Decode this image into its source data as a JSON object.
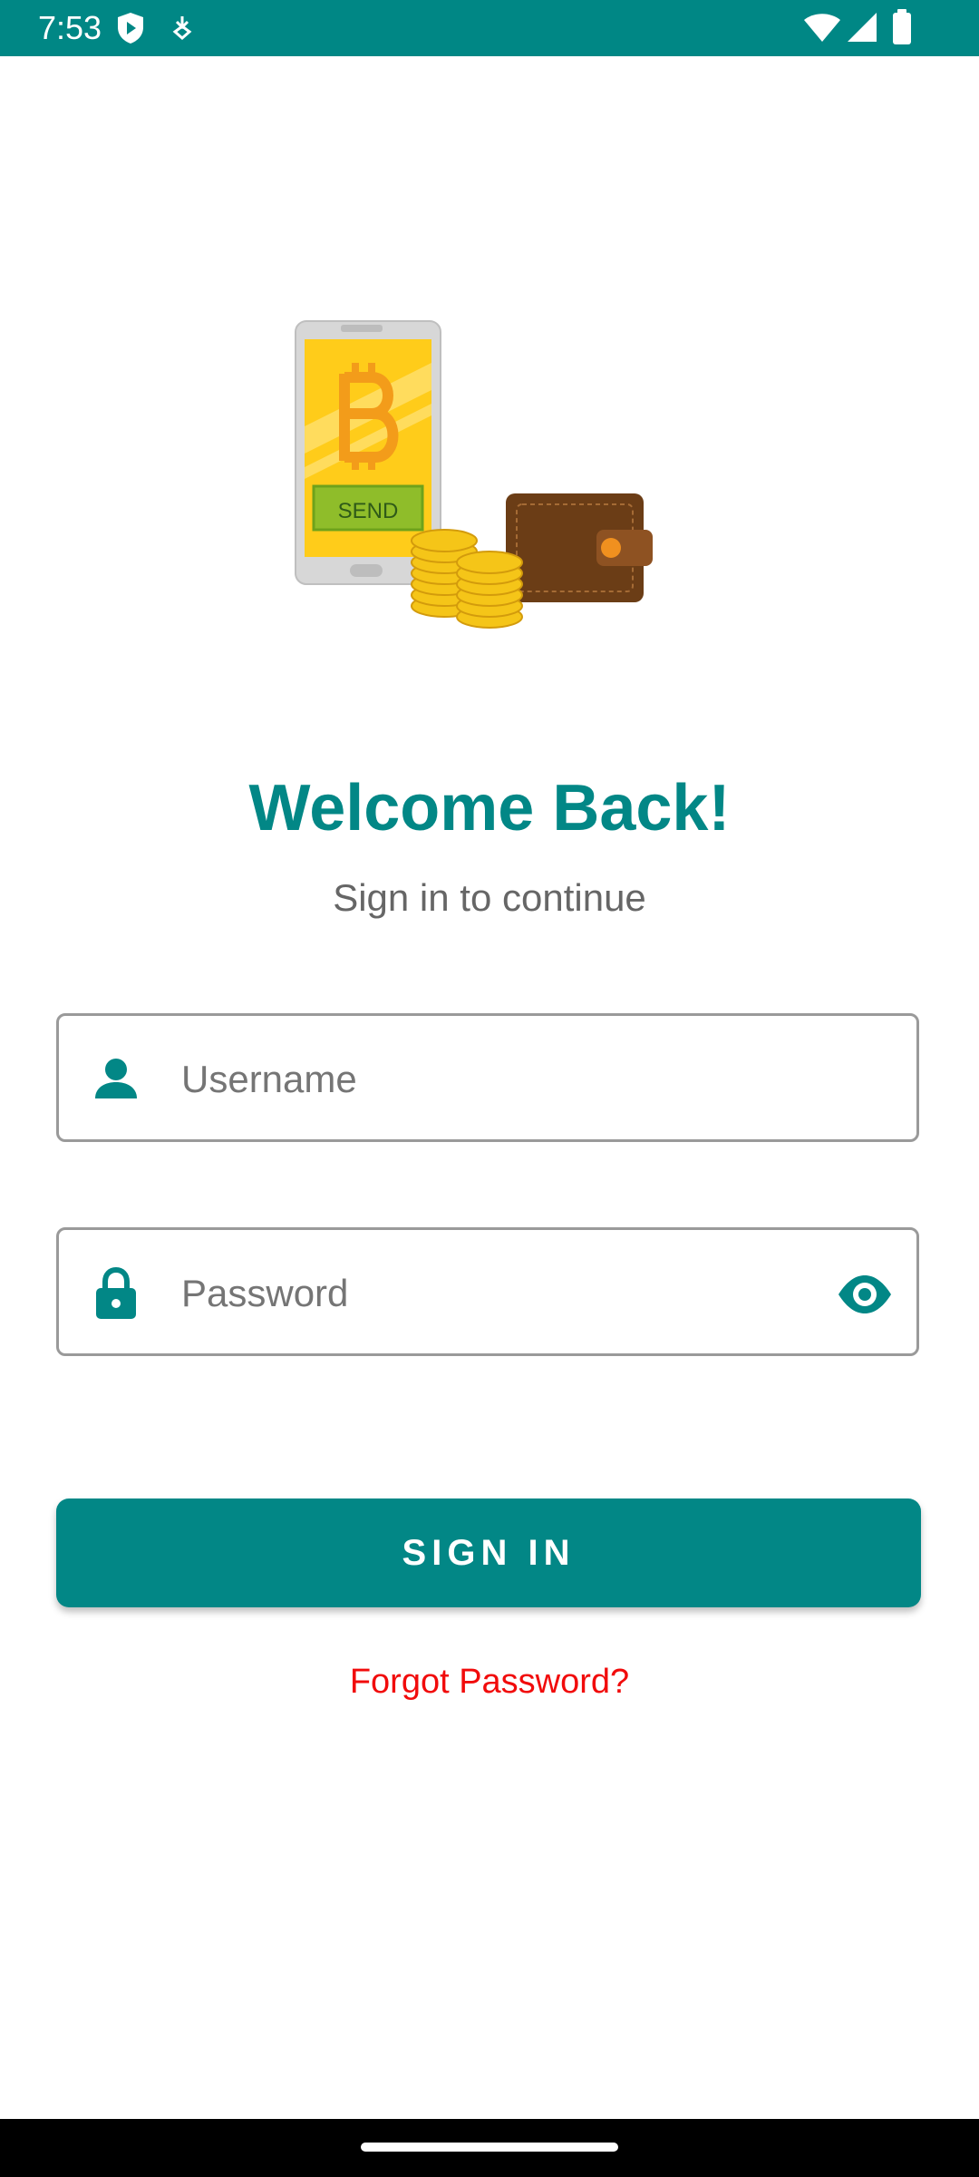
{
  "status_bar": {
    "time": "7:53",
    "icons": [
      "shield-play-icon",
      "download-icon",
      "wifi-icon",
      "signal-icon",
      "battery-icon"
    ],
    "background_color": "#008785"
  },
  "hero": {
    "illustration": "phone-bitcoin-wallet-coins-illustration",
    "send_label": "SEND"
  },
  "header": {
    "title": "Welcome Back!",
    "subtitle": "Sign in to continue"
  },
  "form": {
    "username": {
      "placeholder": "Username",
      "value": "",
      "icon": "person-icon"
    },
    "password": {
      "placeholder": "Password",
      "value": "",
      "icon": "lock-icon",
      "toggle_icon": "eye-icon"
    }
  },
  "actions": {
    "sign_in_label": "SIGN IN",
    "forgot_password_label": "Forgot Password?"
  },
  "colors": {
    "accent": "#028786",
    "link": "#f10b0b"
  }
}
